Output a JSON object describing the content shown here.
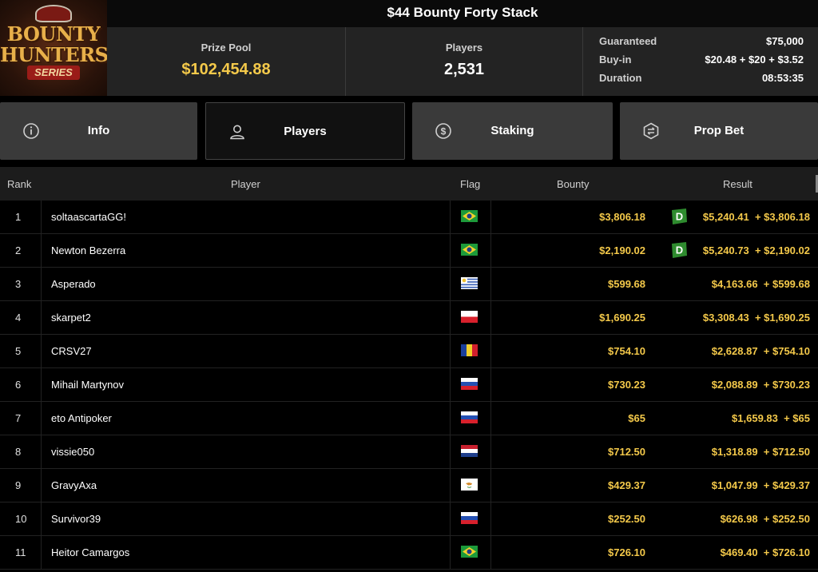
{
  "logo": {
    "line1": "BOUNTY",
    "line2": "HUNTERS",
    "series": "SERIES"
  },
  "title": "$44 Bounty Forty Stack",
  "stats": {
    "prize_pool_label": "Prize Pool",
    "prize_pool_value": "$102,454.88",
    "players_label": "Players",
    "players_value": "2,531",
    "guaranteed_label": "Guaranteed",
    "guaranteed_value": "$75,000",
    "buyin_label": "Buy-in",
    "buyin_value": "$20.48 + $20 + $3.52",
    "duration_label": "Duration",
    "duration_value": "08:53:35"
  },
  "tabs": [
    {
      "label": "Info",
      "icon": "info-icon"
    },
    {
      "label": "Players",
      "icon": "user-icon"
    },
    {
      "label": "Staking",
      "icon": "dollar-icon"
    },
    {
      "label": "Prop Bet",
      "icon": "prop-bet-icon"
    }
  ],
  "table": {
    "headers": {
      "rank": "Rank",
      "player": "Player",
      "flag": "Flag",
      "bounty": "Bounty",
      "result": "Result"
    },
    "rows": [
      {
        "rank": "1",
        "player": "soltaascartaGG!",
        "flag": "brazil",
        "bounty": "$3,806.18",
        "result": "$5,240.41  + $3,806.18",
        "badge": true
      },
      {
        "rank": "2",
        "player": "Newton Bezerra",
        "flag": "brazil",
        "bounty": "$2,190.02",
        "result": "$5,240.73  + $2,190.02",
        "badge": true
      },
      {
        "rank": "3",
        "player": "Asperado",
        "flag": "uruguay",
        "bounty": "$599.68",
        "result": "$4,163.66  + $599.68",
        "badge": false
      },
      {
        "rank": "4",
        "player": "skarpet2",
        "flag": "poland",
        "bounty": "$1,690.25",
        "result": "$3,308.43  + $1,690.25",
        "badge": false
      },
      {
        "rank": "5",
        "player": "CRSV27",
        "flag": "romania",
        "bounty": "$754.10",
        "result": "$2,628.87  + $754.10",
        "badge": false
      },
      {
        "rank": "6",
        "player": "Mihail Martynov",
        "flag": "russia",
        "bounty": "$730.23",
        "result": "$2,088.89  + $730.23",
        "badge": false
      },
      {
        "rank": "7",
        "player": "eto Antipoker",
        "flag": "russia",
        "bounty": "$65",
        "result": "$1,659.83  + $65",
        "badge": false
      },
      {
        "rank": "8",
        "player": "vissie050",
        "flag": "netherlands",
        "bounty": "$712.50",
        "result": "$1,318.89  + $712.50",
        "badge": false
      },
      {
        "rank": "9",
        "player": "GravyAxa",
        "flag": "cyprus",
        "bounty": "$429.37",
        "result": "$1,047.99  + $429.37",
        "badge": false
      },
      {
        "rank": "10",
        "player": "Survivor39",
        "flag": "russia",
        "bounty": "$252.50",
        "result": "$626.98  + $252.50",
        "badge": false
      },
      {
        "rank": "11",
        "player": "Heitor Camargos",
        "flag": "brazil",
        "bounty": "$726.10",
        "result": "$469.40  + $726.10",
        "badge": false
      }
    ]
  },
  "colors": {
    "accent_gold": "#f4c94a",
    "badge_green": "#2e8b2e"
  }
}
